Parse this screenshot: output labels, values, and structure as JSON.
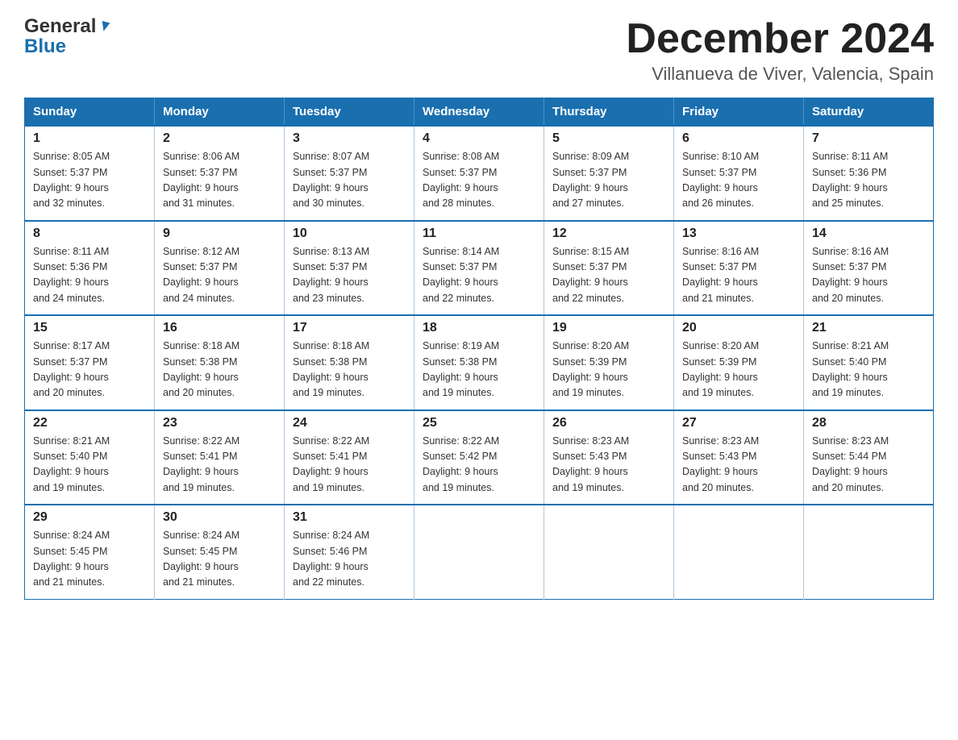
{
  "header": {
    "title": "December 2024",
    "subtitle": "Villanueva de Viver, Valencia, Spain",
    "logo_general": "General",
    "logo_blue": "Blue"
  },
  "days_of_week": [
    "Sunday",
    "Monday",
    "Tuesday",
    "Wednesday",
    "Thursday",
    "Friday",
    "Saturday"
  ],
  "weeks": [
    [
      {
        "day": "1",
        "sunrise": "8:05 AM",
        "sunset": "5:37 PM",
        "daylight": "9 hours and 32 minutes."
      },
      {
        "day": "2",
        "sunrise": "8:06 AM",
        "sunset": "5:37 PM",
        "daylight": "9 hours and 31 minutes."
      },
      {
        "day": "3",
        "sunrise": "8:07 AM",
        "sunset": "5:37 PM",
        "daylight": "9 hours and 30 minutes."
      },
      {
        "day": "4",
        "sunrise": "8:08 AM",
        "sunset": "5:37 PM",
        "daylight": "9 hours and 28 minutes."
      },
      {
        "day": "5",
        "sunrise": "8:09 AM",
        "sunset": "5:37 PM",
        "daylight": "9 hours and 27 minutes."
      },
      {
        "day": "6",
        "sunrise": "8:10 AM",
        "sunset": "5:37 PM",
        "daylight": "9 hours and 26 minutes."
      },
      {
        "day": "7",
        "sunrise": "8:11 AM",
        "sunset": "5:36 PM",
        "daylight": "9 hours and 25 minutes."
      }
    ],
    [
      {
        "day": "8",
        "sunrise": "8:11 AM",
        "sunset": "5:36 PM",
        "daylight": "9 hours and 24 minutes."
      },
      {
        "day": "9",
        "sunrise": "8:12 AM",
        "sunset": "5:37 PM",
        "daylight": "9 hours and 24 minutes."
      },
      {
        "day": "10",
        "sunrise": "8:13 AM",
        "sunset": "5:37 PM",
        "daylight": "9 hours and 23 minutes."
      },
      {
        "day": "11",
        "sunrise": "8:14 AM",
        "sunset": "5:37 PM",
        "daylight": "9 hours and 22 minutes."
      },
      {
        "day": "12",
        "sunrise": "8:15 AM",
        "sunset": "5:37 PM",
        "daylight": "9 hours and 22 minutes."
      },
      {
        "day": "13",
        "sunrise": "8:16 AM",
        "sunset": "5:37 PM",
        "daylight": "9 hours and 21 minutes."
      },
      {
        "day": "14",
        "sunrise": "8:16 AM",
        "sunset": "5:37 PM",
        "daylight": "9 hours and 20 minutes."
      }
    ],
    [
      {
        "day": "15",
        "sunrise": "8:17 AM",
        "sunset": "5:37 PM",
        "daylight": "9 hours and 20 minutes."
      },
      {
        "day": "16",
        "sunrise": "8:18 AM",
        "sunset": "5:38 PM",
        "daylight": "9 hours and 20 minutes."
      },
      {
        "day": "17",
        "sunrise": "8:18 AM",
        "sunset": "5:38 PM",
        "daylight": "9 hours and 19 minutes."
      },
      {
        "day": "18",
        "sunrise": "8:19 AM",
        "sunset": "5:38 PM",
        "daylight": "9 hours and 19 minutes."
      },
      {
        "day": "19",
        "sunrise": "8:20 AM",
        "sunset": "5:39 PM",
        "daylight": "9 hours and 19 minutes."
      },
      {
        "day": "20",
        "sunrise": "8:20 AM",
        "sunset": "5:39 PM",
        "daylight": "9 hours and 19 minutes."
      },
      {
        "day": "21",
        "sunrise": "8:21 AM",
        "sunset": "5:40 PM",
        "daylight": "9 hours and 19 minutes."
      }
    ],
    [
      {
        "day": "22",
        "sunrise": "8:21 AM",
        "sunset": "5:40 PM",
        "daylight": "9 hours and 19 minutes."
      },
      {
        "day": "23",
        "sunrise": "8:22 AM",
        "sunset": "5:41 PM",
        "daylight": "9 hours and 19 minutes."
      },
      {
        "day": "24",
        "sunrise": "8:22 AM",
        "sunset": "5:41 PM",
        "daylight": "9 hours and 19 minutes."
      },
      {
        "day": "25",
        "sunrise": "8:22 AM",
        "sunset": "5:42 PM",
        "daylight": "9 hours and 19 minutes."
      },
      {
        "day": "26",
        "sunrise": "8:23 AM",
        "sunset": "5:43 PM",
        "daylight": "9 hours and 19 minutes."
      },
      {
        "day": "27",
        "sunrise": "8:23 AM",
        "sunset": "5:43 PM",
        "daylight": "9 hours and 20 minutes."
      },
      {
        "day": "28",
        "sunrise": "8:23 AM",
        "sunset": "5:44 PM",
        "daylight": "9 hours and 20 minutes."
      }
    ],
    [
      {
        "day": "29",
        "sunrise": "8:24 AM",
        "sunset": "5:45 PM",
        "daylight": "9 hours and 21 minutes."
      },
      {
        "day": "30",
        "sunrise": "8:24 AM",
        "sunset": "5:45 PM",
        "daylight": "9 hours and 21 minutes."
      },
      {
        "day": "31",
        "sunrise": "8:24 AM",
        "sunset": "5:46 PM",
        "daylight": "9 hours and 22 minutes."
      },
      null,
      null,
      null,
      null
    ]
  ],
  "labels": {
    "sunrise": "Sunrise:",
    "sunset": "Sunset:",
    "daylight": "Daylight:"
  }
}
